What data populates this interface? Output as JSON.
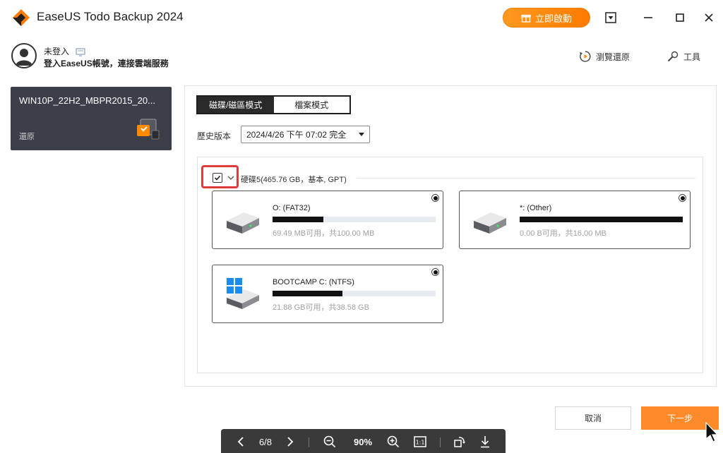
{
  "app": {
    "title": "EaseUS Todo Backup 2024",
    "activate_label": "立即啟動",
    "accent": "#ff8a00"
  },
  "user": {
    "name": "未登入",
    "subtitle": "登入EaseUS帳號，連接雲端服務"
  },
  "tools": {
    "browse_restore": "瀏覽還原",
    "tools": "工具"
  },
  "backup": {
    "name": "WIN10P_22H2_MBPR2015_20...",
    "status": "還原"
  },
  "mode": {
    "disk_mode": "磁碟/磁區模式",
    "file_mode": "檔案模式"
  },
  "history": {
    "label": "歷史版本",
    "value": "2024/4/26 下午 07:02 完全"
  },
  "disk": {
    "title": "硬碟5(465.76 GB，基本, GPT)",
    "checked": true
  },
  "partitions": [
    {
      "label": "O: (FAT32)",
      "size": "69.49 MB可用，共100.00 MB",
      "used_fraction": 0.31,
      "icon": "drive-icon"
    },
    {
      "label": "*: (Other)",
      "size": "0.00 B可用，共16.00 MB",
      "used_fraction": 1.0,
      "icon": "drive-icon"
    },
    {
      "label": "BOOTCAMP C: (NTFS)",
      "size": "21.88 GB可用，共38.58 GB",
      "used_fraction": 0.43,
      "icon": "windows-drive-icon"
    }
  ],
  "footer": {
    "cancel": "取消",
    "next": "下一步"
  },
  "viewer": {
    "page": "6/8",
    "zoom": "90%"
  }
}
